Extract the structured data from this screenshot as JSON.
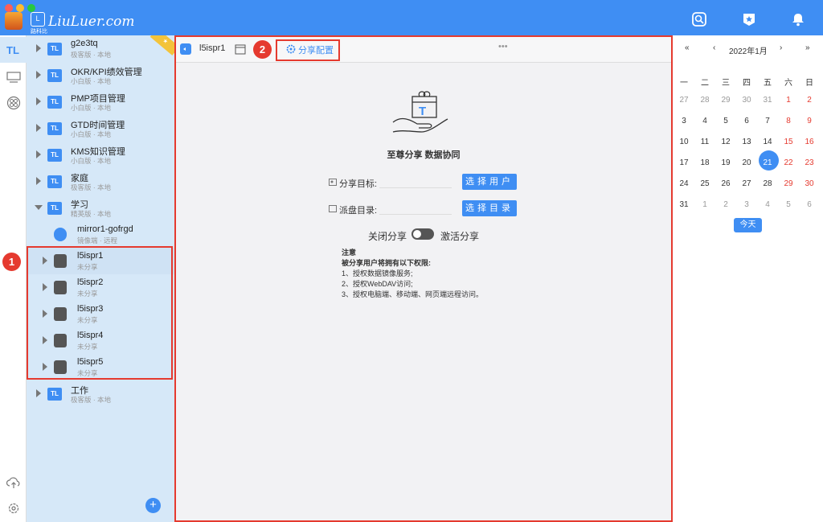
{
  "window": {
    "logo_text": "LiuLuer.com",
    "logo_sub": "路科比"
  },
  "tree": {
    "items": [
      {
        "name": "g2e3tq",
        "sub": "极客版 · 本地"
      },
      {
        "name": "OKR/KPI绩效管理",
        "sub": "小白版 · 本地"
      },
      {
        "name": "PMP项目管理",
        "sub": "小白版 · 本地"
      },
      {
        "name": "GTD时间管理",
        "sub": "小白版 · 本地"
      },
      {
        "name": "KMS知识管理",
        "sub": "小白版 · 本地"
      },
      {
        "name": "家庭",
        "sub": "极客版 · 本地"
      },
      {
        "name": "学习",
        "sub": "精英版 · 本地"
      },
      {
        "name": "mirror1-gofrgd",
        "sub": "镜像端 · 远程"
      },
      {
        "name": "l5ispr1",
        "sub": "未分享"
      },
      {
        "name": "l5ispr2",
        "sub": "未分享"
      },
      {
        "name": "l5ispr3",
        "sub": "未分享"
      },
      {
        "name": "l5ispr4",
        "sub": "未分享"
      },
      {
        "name": "l5ispr5",
        "sub": "未分享"
      },
      {
        "name": "工作",
        "sub": "极客版 · 本地"
      }
    ],
    "badge_1": "1"
  },
  "toolbar": {
    "title": "l5ispr1",
    "share_config_label": "分享配置",
    "more_label": "•••",
    "badge_2": "2"
  },
  "share": {
    "heading": "至尊分享 数据协同",
    "target_label": "分享目标:",
    "dir_label": "派盘目录:",
    "select_user_btn": "选择用户",
    "select_dir_btn": "选择目录",
    "off_label": "关闭分享",
    "on_label": "激活分享",
    "note_title": "注意",
    "note_subtitle": "被分享用户将拥有以下权限:",
    "note_1": "1、授权数据镜像服务;",
    "note_2": "2、授权WebDAV访问;",
    "note_3": "3、授权电脑端、移动端、网页端远程访问。"
  },
  "calendar": {
    "month_label": "2022年1月",
    "nav_first": "«",
    "nav_prev": "‹",
    "nav_next": "›",
    "nav_last": "»",
    "weekdays": [
      "一",
      "二",
      "三",
      "四",
      "五",
      "六",
      "日"
    ],
    "weeks": [
      [
        "27",
        "28",
        "29",
        "30",
        "31",
        "1",
        "2"
      ],
      [
        "3",
        "4",
        "5",
        "6",
        "7",
        "8",
        "9"
      ],
      [
        "10",
        "11",
        "12",
        "13",
        "14",
        "15",
        "16"
      ],
      [
        "17",
        "18",
        "19",
        "20",
        "21",
        "22",
        "23"
      ],
      [
        "24",
        "25",
        "26",
        "27",
        "28",
        "29",
        "30"
      ],
      [
        "31",
        "1",
        "2",
        "3",
        "4",
        "5",
        "6"
      ]
    ],
    "selected_day": "21",
    "today_label": "今天"
  },
  "colors": {
    "accent": "#3f8ef3",
    "highlight": "#e53a2f"
  }
}
